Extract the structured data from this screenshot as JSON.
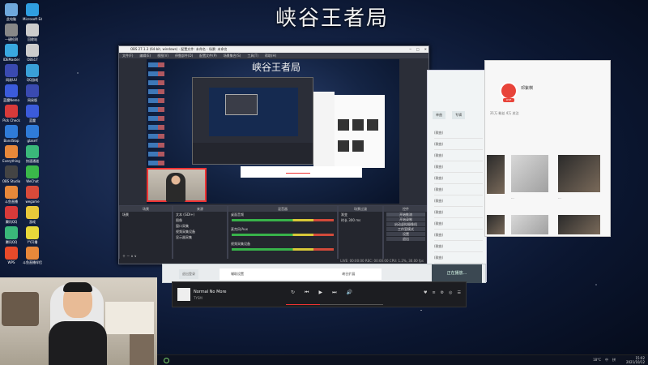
{
  "stream": {
    "title": "峡谷王者局"
  },
  "desktop": {
    "icons": [
      {
        "label": "此电脑",
        "color": "#6fa8dc"
      },
      {
        "label": "Microsoft Edge",
        "color": "#2f9ee0"
      },
      {
        "label": "一键检测",
        "color": "#888888"
      },
      {
        "label": "回收站",
        "color": "#cccccc"
      },
      {
        "label": "IDEMaster",
        "color": "#39a8e0"
      },
      {
        "label": "OBS17",
        "color": "#cccccc"
      },
      {
        "label": "网易UU",
        "color": "#3a4ab0"
      },
      {
        "label": "QQ游戏",
        "color": "#3aa0d8"
      },
      {
        "label": "蓝魔Nemo",
        "color": "#3b5bdb"
      },
      {
        "label": "网易版",
        "color": "#3a4ab0"
      },
      {
        "label": "Pick Check",
        "color": "#d83a3a"
      },
      {
        "label": "蓝魔",
        "color": "#3b5bdb"
      },
      {
        "label": "BandSlop",
        "color": "#2f7bd8"
      },
      {
        "label": "glaseY",
        "color": "#2f7bd8"
      },
      {
        "label": "Everything",
        "color": "#e8883a"
      },
      {
        "label": "快速通道",
        "color": "#3ab87a"
      },
      {
        "label": "OBS Studio",
        "color": "#444444"
      },
      {
        "label": "WeChat",
        "color": "#3ab84a"
      },
      {
        "label": "斗鱼直播",
        "color": "#e8883a"
      },
      {
        "label": "wegame",
        "color": "#d84a3a"
      },
      {
        "label": "腾讯QQ",
        "color": "#d83a3a"
      },
      {
        "label": "游戏",
        "color": "#e8c83a"
      },
      {
        "label": "腾讯QQ",
        "color": "#3ab87a"
      },
      {
        "label": "YY开播",
        "color": "#e8d83a"
      },
      {
        "label": "WPS",
        "color": "#e84a2a"
      },
      {
        "label": "斗鱼直播伴侣",
        "color": "#e8883a"
      }
    ]
  },
  "obs": {
    "window_title": "OBS 27.1.3 (64-bit, windows) - 配置文件: 未命名 - 场景: 未命名",
    "menu": [
      "文件(F)",
      "编辑(E)",
      "视图(V)",
      "停靠部件(D)",
      "配置文件(P)",
      "场景集合(S)",
      "工具(T)",
      "帮助(H)"
    ],
    "preview_title": "峡谷王者局",
    "scenes_header": "场景",
    "scenes": [
      "场景"
    ],
    "sources_header": "来源",
    "sources": [
      "文本 (GDI+)",
      "图像",
      "窗口采集",
      "视频采集设备",
      "显示器采集"
    ],
    "mixer_header": "混音器",
    "mixer": [
      "桌面音频",
      "麦克风/Aux",
      "视频采集设备"
    ],
    "transitions_header": "场景过渡",
    "transition_value": "渐变",
    "duration_label": "时长",
    "duration_value": "300 ms",
    "controls_header": "控件",
    "controls": [
      "开始推流",
      "开始录制",
      "启动虚拟摄像机",
      "工作室模式",
      "设置",
      "退出"
    ],
    "status": "LIVE: 00:00:00  REC: 00:00:00  CPU: 1.2%, 30.00 fps"
  },
  "mid_panel": {
    "tabs": [
      "单曲",
      "专辑"
    ],
    "rows": [
      "(歌曲)",
      "(歌曲)",
      "(歌曲)",
      "(歌曲)",
      "(歌曲)",
      "(歌曲)",
      "(歌曲)",
      "(歌曲)",
      "(歌曲)",
      "(歌曲)",
      "(歌曲)",
      "(歌曲)",
      "(歌曲)"
    ]
  },
  "music_app": {
    "artist_name": "邓紫棋",
    "fans": "21万 粉丝  4万 关注",
    "badge": "LIVE",
    "captions": [
      "...",
      "...",
      "...",
      "..."
    ]
  },
  "play_panel": {
    "left_btn": "退出登录",
    "row_text": "辅助设置",
    "row_status": "峡谷扩展",
    "right_btn": "正在播放..."
  },
  "player": {
    "song": "Normal No More",
    "artist": "TYSM",
    "controls": [
      "↻",
      "⏮",
      "▶",
      "⏭",
      "🔊"
    ],
    "progress": 0.35,
    "right_controls": [
      "♥",
      "≡",
      "⚙",
      "◎",
      "☰"
    ]
  },
  "taskbar": {
    "tray": [
      "18°C",
      "中",
      "拼"
    ],
    "time": "15:02",
    "date": "2021/10/12"
  }
}
